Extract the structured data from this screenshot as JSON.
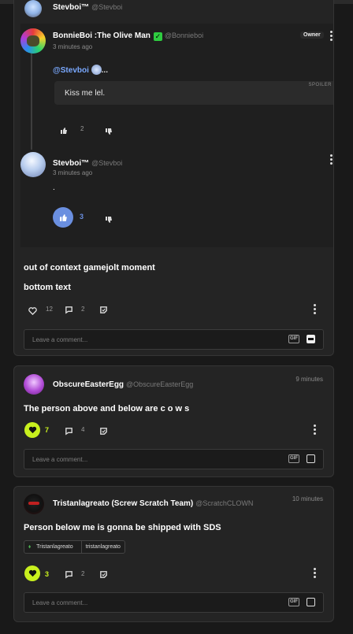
{
  "reply_header": {
    "username": "Stevboi™",
    "handle": "@Stevboi"
  },
  "reply1": {
    "username": "BonnieBoi :The Olive Man",
    "handle": "@Bonnieboi",
    "badge": "Owner",
    "time": "3 minutes ago",
    "mention": "@Stevboi",
    "mention_suffix": "...",
    "spoiler_label": "SPOILER",
    "spoiler_text": "Kiss me lel.",
    "likes": "2"
  },
  "reply2": {
    "username": "Stevboi™",
    "handle": "@Stevboi",
    "time": "3 minutes ago",
    "body": ".",
    "likes": "3"
  },
  "post1": {
    "title": "out of context gamejolt moment",
    "body": "bottom text",
    "likes": "12",
    "comments": "2",
    "comment_placeholder": "Leave a comment..."
  },
  "post2": {
    "username": "ObscureEasterEgg",
    "handle": "@ObscureEasterEgg",
    "time": "9 minutes",
    "body": "The person above and below are c o w s",
    "likes": "7",
    "comments": "4",
    "comment_placeholder": "Leave a comment..."
  },
  "post3": {
    "username": "Tristanlagreato (Screw Scratch Team)",
    "handle": "@ScratchCLOWN",
    "time": "10 minutes",
    "body": "Person below me is gonna be shipped with SDS",
    "chip_name": "Tristanlagreato",
    "chip_value": "tristanlagreato",
    "likes": "3",
    "comments": "2",
    "comment_placeholder": "Leave a comment..."
  },
  "gif_label": "GIF",
  "colors": {
    "accent_green": "#c8f01e",
    "accent_blue": "#6a8fe0",
    "verified": "#2ecc40",
    "mention": "#7aa9ff"
  },
  "icons": [
    "heart-icon",
    "thumbs-up-icon",
    "thumbs-down-icon",
    "comment-icon",
    "sticker-icon",
    "more-icon",
    "gif-icon",
    "verified-icon"
  ]
}
